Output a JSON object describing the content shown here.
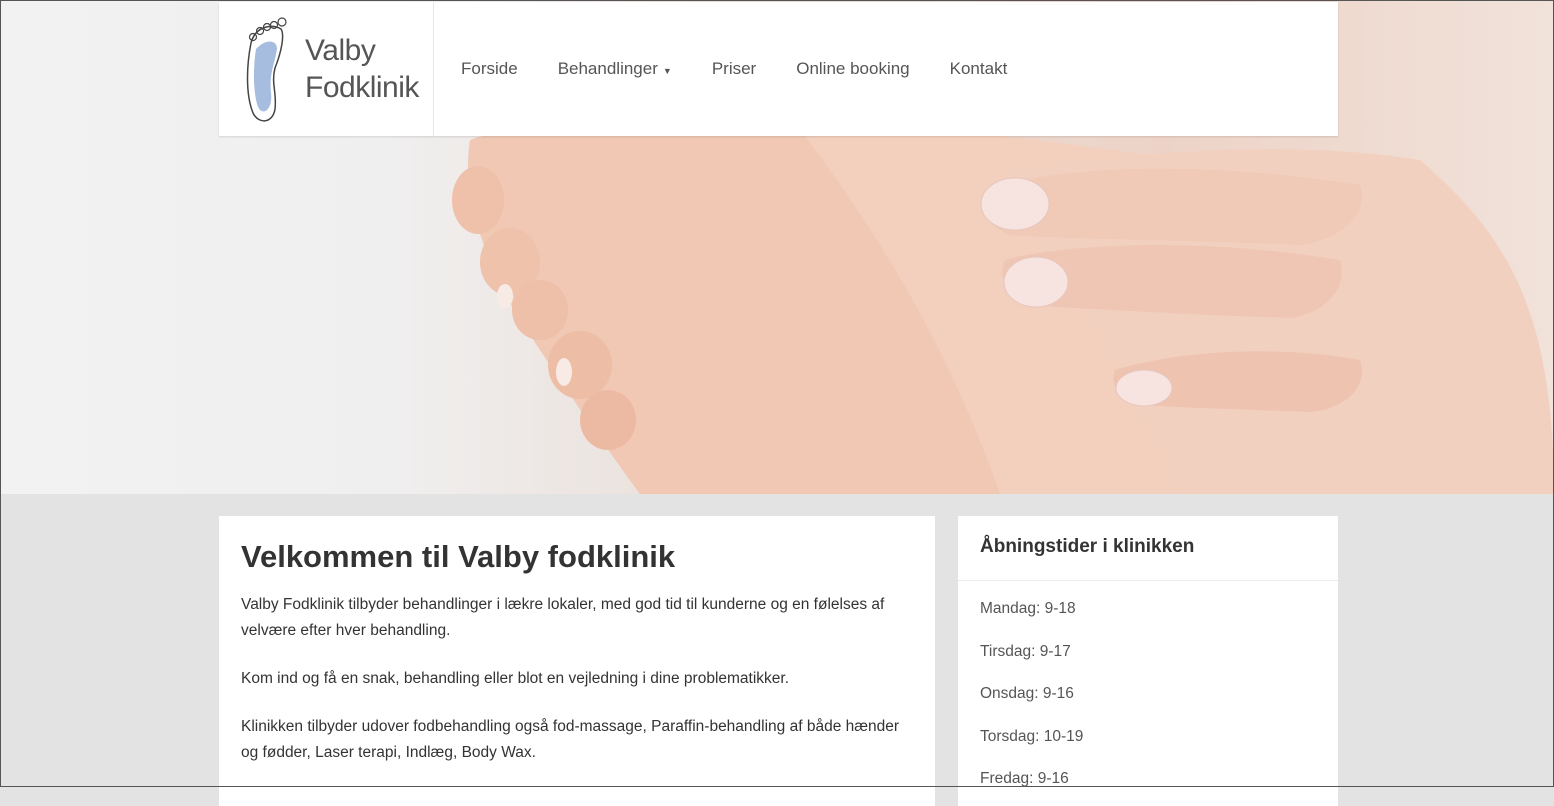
{
  "brand": {
    "line1": "Valby",
    "line2": "Fodklinik",
    "logo_icon": "foot-icon"
  },
  "nav": [
    {
      "label": "Forside",
      "has_dropdown": false
    },
    {
      "label": "Behandlinger",
      "has_dropdown": true
    },
    {
      "label": "Priser",
      "has_dropdown": false
    },
    {
      "label": "Online booking",
      "has_dropdown": false
    },
    {
      "label": "Kontakt",
      "has_dropdown": false
    }
  ],
  "main": {
    "title": "Velkommen til Valby fodklinik",
    "paragraphs": [
      "Valby Fodklinik tilbyder behandlinger i lækre lokaler, med god tid til kunderne og en følelses af velvære efter hver behandling.",
      "Kom ind og få en snak, behandling eller blot en vejledning i dine problematikker.",
      "Klinikken tilbyder udover fodbehandling også fod-massage, Paraffin-behandling af både hænder og fødder, Laser terapi, Indlæg, Body Wax."
    ]
  },
  "sidebar": {
    "title": "Åbningstider i klinikken",
    "hours": [
      "Mandag: 9-18",
      "Tirsdag: 9-17",
      "Onsdag: 9-16",
      "Torsdag: 10-19",
      "Fredag: 9-16"
    ]
  },
  "colors": {
    "page_bg": "#e3e3e3",
    "card_bg": "#ffffff",
    "text": "#333333",
    "logo_foot": "#a6bde0"
  }
}
